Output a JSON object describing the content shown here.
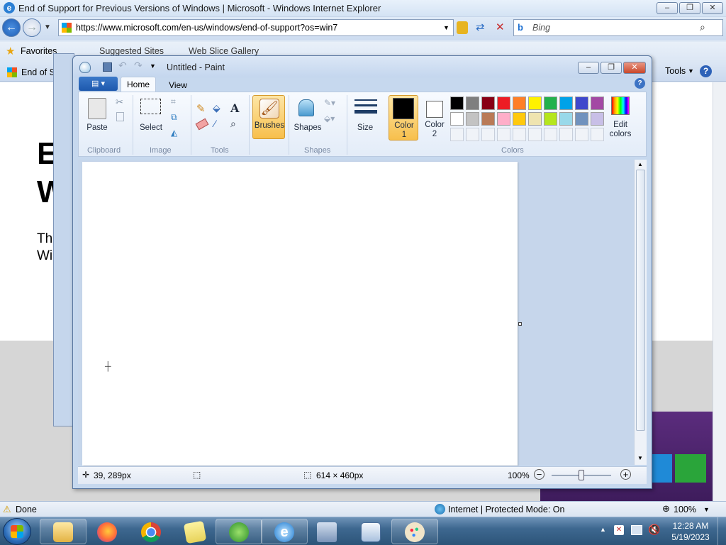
{
  "ie": {
    "title": "End of Support for Previous Versions of Windows | Microsoft - Windows Internet Explorer",
    "address": "https://www.microsoft.com/en-us/windows/end-of-support?os=win7",
    "search_placeholder": "Bing",
    "favorites_label": "Favorites",
    "suggested_sites": "Suggested Sites",
    "web_slice_gallery": "Web Slice Gallery",
    "tab_label": "End of Su",
    "tools_label": "Tools",
    "page_heading_line1": "E",
    "page_heading_line2": "W",
    "page_text_line1": "Thi",
    "page_text_line2": "Wi",
    "status_done": "Done",
    "status_zone": "Internet | Protected Mode: On",
    "status_zoom": "100%"
  },
  "paint": {
    "title": "Untitled - Paint",
    "tabs": [
      "Home",
      "View"
    ],
    "groups": {
      "clipboard": "Clipboard",
      "image": "Image",
      "tools": "Tools",
      "shapes": "Shapes",
      "colors": "Colors"
    },
    "buttons": {
      "paste": "Paste",
      "select": "Select",
      "brushes": "Brushes",
      "shapes": "Shapes",
      "size": "Size",
      "color1_a": "Color",
      "color1_b": "1",
      "color2_a": "Color",
      "color2_b": "2",
      "edit_colors_a": "Edit",
      "edit_colors_b": "colors"
    },
    "palette_row1": [
      "#000000",
      "#7f7f7f",
      "#880015",
      "#ed1c24",
      "#ff7f27",
      "#fff200",
      "#22b14c",
      "#00a2e8",
      "#3f48cc",
      "#a349a4"
    ],
    "palette_row2": [
      "#ffffff",
      "#c3c3c3",
      "#b97a57",
      "#ffaec9",
      "#ffc90e",
      "#efe4b0",
      "#b5e61d",
      "#99d9ea",
      "#7092be",
      "#c8bfe7"
    ],
    "color1": "#000000",
    "color2": "#ffffff",
    "status": {
      "cursor_pos": "39, 289px",
      "canvas_size": "614 × 460px",
      "zoom": "100%"
    }
  },
  "taskbar": {
    "time": "12:28 AM",
    "date": "5/19/2023"
  }
}
